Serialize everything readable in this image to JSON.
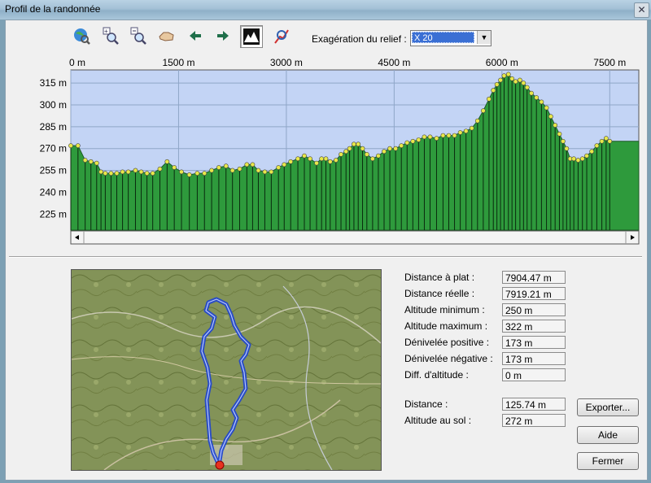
{
  "window": {
    "title": "Profil de la randonnée",
    "close_glyph": "✕"
  },
  "toolbar": {
    "buttons": [
      "globe-zoom-icon",
      "zoom-in-icon",
      "zoom-out-icon",
      "pan-hand-icon",
      "arrow-left-icon",
      "arrow-right-icon",
      "relief-profile-icon",
      "search-path-icon"
    ],
    "exaggeration_label": "Exagération du relief :",
    "exaggeration_value": "X 20"
  },
  "chart_data": {
    "type": "area",
    "x_unit": "m",
    "x_ticks": [
      "0 m",
      "1500 m",
      "3000 m",
      "4500 m",
      "6000 m",
      "7500 m"
    ],
    "x_tick_values": [
      0,
      1500,
      3000,
      4500,
      6000,
      7500
    ],
    "y_ticks": [
      "315 m",
      "300 m",
      "285 m",
      "270 m",
      "255 m",
      "240 m",
      "225 m"
    ],
    "y_tick_values": [
      315,
      300,
      285,
      270,
      255,
      240,
      225
    ],
    "xlim": [
      0,
      7904.47
    ],
    "ylim": [
      214,
      324
    ],
    "grid": true,
    "colors": {
      "plot_bg": "#c3d4f5",
      "fill": "#2e9a3c",
      "stem": "#0a2a0e",
      "point": "#e8e84a"
    },
    "points": [
      {
        "x": 0,
        "y": 272
      },
      {
        "x": 100,
        "y": 272
      },
      {
        "x": 200,
        "y": 262
      },
      {
        "x": 280,
        "y": 261
      },
      {
        "x": 360,
        "y": 260
      },
      {
        "x": 420,
        "y": 254
      },
      {
        "x": 480,
        "y": 253
      },
      {
        "x": 560,
        "y": 253
      },
      {
        "x": 640,
        "y": 253
      },
      {
        "x": 720,
        "y": 254
      },
      {
        "x": 800,
        "y": 254
      },
      {
        "x": 900,
        "y": 255
      },
      {
        "x": 980,
        "y": 254
      },
      {
        "x": 1060,
        "y": 253
      },
      {
        "x": 1140,
        "y": 253
      },
      {
        "x": 1240,
        "y": 256
      },
      {
        "x": 1340,
        "y": 261
      },
      {
        "x": 1440,
        "y": 257
      },
      {
        "x": 1540,
        "y": 254
      },
      {
        "x": 1650,
        "y": 252
      },
      {
        "x": 1760,
        "y": 253
      },
      {
        "x": 1860,
        "y": 253
      },
      {
        "x": 1960,
        "y": 255
      },
      {
        "x": 2060,
        "y": 257
      },
      {
        "x": 2160,
        "y": 258
      },
      {
        "x": 2250,
        "y": 255
      },
      {
        "x": 2350,
        "y": 256
      },
      {
        "x": 2450,
        "y": 259
      },
      {
        "x": 2530,
        "y": 259
      },
      {
        "x": 2610,
        "y": 255
      },
      {
        "x": 2700,
        "y": 254
      },
      {
        "x": 2790,
        "y": 254
      },
      {
        "x": 2890,
        "y": 257
      },
      {
        "x": 2970,
        "y": 259
      },
      {
        "x": 3060,
        "y": 261
      },
      {
        "x": 3160,
        "y": 263
      },
      {
        "x": 3250,
        "y": 265
      },
      {
        "x": 3330,
        "y": 263
      },
      {
        "x": 3420,
        "y": 260
      },
      {
        "x": 3490,
        "y": 263
      },
      {
        "x": 3550,
        "y": 263
      },
      {
        "x": 3610,
        "y": 261
      },
      {
        "x": 3690,
        "y": 262
      },
      {
        "x": 3760,
        "y": 266
      },
      {
        "x": 3830,
        "y": 268
      },
      {
        "x": 3880,
        "y": 270
      },
      {
        "x": 3940,
        "y": 273
      },
      {
        "x": 4000,
        "y": 273
      },
      {
        "x": 4060,
        "y": 270
      },
      {
        "x": 4120,
        "y": 266
      },
      {
        "x": 4200,
        "y": 263
      },
      {
        "x": 4280,
        "y": 265
      },
      {
        "x": 4360,
        "y": 268
      },
      {
        "x": 4440,
        "y": 270
      },
      {
        "x": 4520,
        "y": 270
      },
      {
        "x": 4600,
        "y": 272
      },
      {
        "x": 4680,
        "y": 274
      },
      {
        "x": 4760,
        "y": 275
      },
      {
        "x": 4840,
        "y": 276
      },
      {
        "x": 4920,
        "y": 278
      },
      {
        "x": 5000,
        "y": 278
      },
      {
        "x": 5090,
        "y": 277
      },
      {
        "x": 5180,
        "y": 279
      },
      {
        "x": 5260,
        "y": 279
      },
      {
        "x": 5340,
        "y": 279
      },
      {
        "x": 5420,
        "y": 281
      },
      {
        "x": 5500,
        "y": 282
      },
      {
        "x": 5580,
        "y": 284
      },
      {
        "x": 5660,
        "y": 289
      },
      {
        "x": 5740,
        "y": 296
      },
      {
        "x": 5820,
        "y": 304
      },
      {
        "x": 5880,
        "y": 310
      },
      {
        "x": 5930,
        "y": 314
      },
      {
        "x": 5980,
        "y": 317
      },
      {
        "x": 6030,
        "y": 320
      },
      {
        "x": 6090,
        "y": 321
      },
      {
        "x": 6140,
        "y": 318
      },
      {
        "x": 6190,
        "y": 316
      },
      {
        "x": 6250,
        "y": 317
      },
      {
        "x": 6300,
        "y": 315
      },
      {
        "x": 6350,
        "y": 312
      },
      {
        "x": 6410,
        "y": 308
      },
      {
        "x": 6480,
        "y": 305
      },
      {
        "x": 6550,
        "y": 302
      },
      {
        "x": 6620,
        "y": 298
      },
      {
        "x": 6680,
        "y": 292
      },
      {
        "x": 6740,
        "y": 286
      },
      {
        "x": 6800,
        "y": 280
      },
      {
        "x": 6850,
        "y": 275
      },
      {
        "x": 6900,
        "y": 270
      },
      {
        "x": 6950,
        "y": 263
      },
      {
        "x": 7000,
        "y": 263
      },
      {
        "x": 7060,
        "y": 262
      },
      {
        "x": 7120,
        "y": 263
      },
      {
        "x": 7180,
        "y": 265
      },
      {
        "x": 7250,
        "y": 268
      },
      {
        "x": 7320,
        "y": 272
      },
      {
        "x": 7390,
        "y": 275
      },
      {
        "x": 7450,
        "y": 277
      },
      {
        "x": 7500,
        "y": 275
      }
    ]
  },
  "stats": [
    {
      "label": "Distance à plat :",
      "value": "7904.47 m"
    },
    {
      "label": "Distance réelle :",
      "value": "7919.21 m"
    },
    {
      "label": "Altitude minimum :",
      "value": "250 m"
    },
    {
      "label": "Altitude maximum :",
      "value": "322 m"
    },
    {
      "label": "Dénivelée positive :",
      "value": "173 m"
    },
    {
      "label": "Dénivelée négative :",
      "value": "173 m"
    },
    {
      "label": "Diff. d'altitude :",
      "value": "0 m"
    }
  ],
  "cursor": [
    {
      "label": "Distance :",
      "value": "125.74 m"
    },
    {
      "label": "Altitude au sol :",
      "value": "272 m"
    }
  ],
  "buttons": {
    "export": "Exporter...",
    "help": "Aide",
    "close": "Fermer"
  },
  "map": {
    "track_color": "#1f45d0",
    "start_color": "#e8321f"
  }
}
